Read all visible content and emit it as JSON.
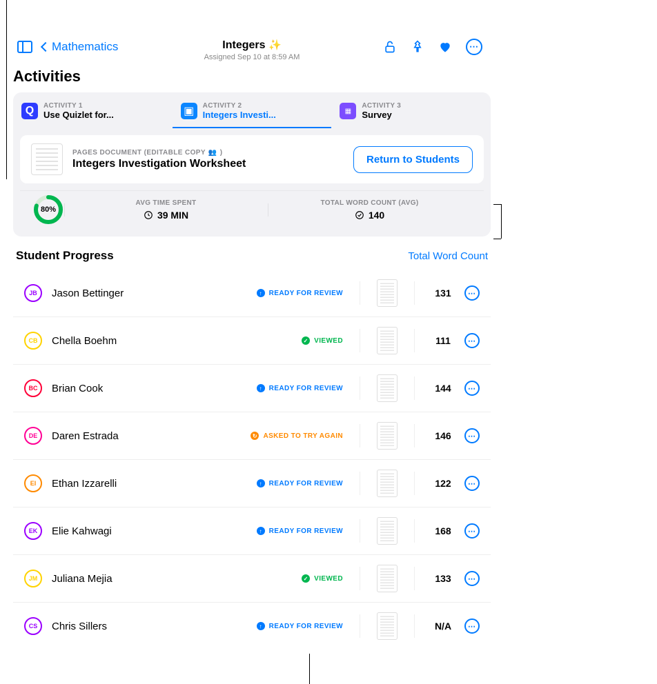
{
  "header": {
    "back_label": "Mathematics",
    "title": "Integers",
    "sparkle": "✨",
    "subtitle": "Assigned Sep 10 at 8:59 AM"
  },
  "section_title": "Activities",
  "tabs": [
    {
      "over": "ACTIVITY 1",
      "name": "Use Quizlet for...",
      "icon_bg": "#0a53ff"
    },
    {
      "over": "ACTIVITY 2",
      "name": "Integers Investi...",
      "icon_bg": "#0b86ff"
    },
    {
      "over": "ACTIVITY 3",
      "name": "Survey",
      "icon_bg": "#7c4dff"
    }
  ],
  "document": {
    "over": "PAGES DOCUMENT (EDITABLE COPY",
    "over_icon": "👥",
    "over_close": ")",
    "title": "Integers Investigation Worksheet",
    "action": "Return to Students"
  },
  "stats": {
    "progress_pct": "80%",
    "time": {
      "over": "AVG TIME SPENT",
      "value": "39 MIN"
    },
    "words": {
      "over": "TOTAL WORD COUNT (AVG)",
      "value": "140"
    }
  },
  "progress": {
    "title": "Student Progress",
    "sort_label": "Total Word Count",
    "students": [
      {
        "initials": "JB",
        "color": "#9b00ff",
        "name": "Jason Bettinger",
        "status": "READY FOR REVIEW",
        "status_color": "#007aff",
        "icon": "arrow",
        "count": "131"
      },
      {
        "initials": "CB",
        "color": "#ffd300",
        "name": "Chella Boehm",
        "status": "VIEWED",
        "status_color": "#00b64f",
        "icon": "check",
        "count": "111"
      },
      {
        "initials": "BC",
        "color": "#ff0038",
        "name": "Brian Cook",
        "status": "READY FOR REVIEW",
        "status_color": "#007aff",
        "icon": "arrow",
        "count": "144"
      },
      {
        "initials": "DE",
        "color": "#ff0095",
        "name": "Daren Estrada",
        "status": "ASKED TO TRY AGAIN",
        "status_color": "#ff8a00",
        "icon": "redo",
        "count": "146"
      },
      {
        "initials": "EI",
        "color": "#ff8a00",
        "name": "Ethan Izzarelli",
        "status": "READY FOR REVIEW",
        "status_color": "#007aff",
        "icon": "arrow",
        "count": "122"
      },
      {
        "initials": "EK",
        "color": "#9b00ff",
        "name": "Elie Kahwagi",
        "status": "READY FOR REVIEW",
        "status_color": "#007aff",
        "icon": "arrow",
        "count": "168"
      },
      {
        "initials": "JM",
        "color": "#ffd300",
        "name": "Juliana Mejia",
        "status": "VIEWED",
        "status_color": "#00b64f",
        "icon": "check",
        "count": "133"
      },
      {
        "initials": "CS",
        "color": "#9b00ff",
        "name": "Chris Sillers",
        "status": "READY FOR REVIEW",
        "status_color": "#007aff",
        "icon": "arrow",
        "count": "N/A"
      }
    ]
  }
}
